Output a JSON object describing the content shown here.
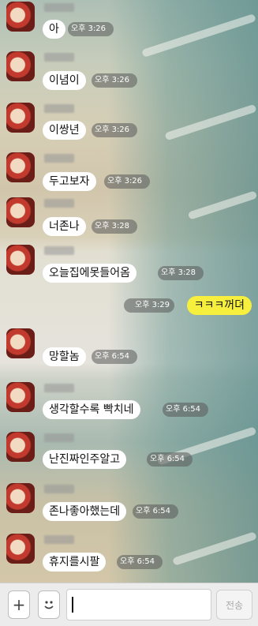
{
  "messages": [
    {
      "text": "아",
      "time": "오후 3:26"
    },
    {
      "text": "이념이",
      "time": "오후 3:26"
    },
    {
      "text": "이쌍년",
      "time": "오후 3:26"
    },
    {
      "text": "두고보자",
      "time": "오후 3:26"
    },
    {
      "text": "너존나",
      "time": "오후 3:28"
    },
    {
      "text": "오늘집에못들어옴",
      "time": "오후 3:28"
    },
    {
      "text": "ㅋㅋㅋ꺼뎌",
      "time": "오후 3:29",
      "mine": true
    },
    {
      "text": "망할놈",
      "time": "오후 6:54"
    },
    {
      "text": "생각할수록 빡치네",
      "time": "오후 6:54"
    },
    {
      "text": "난진짜인주알고",
      "time": "오후 6:54"
    },
    {
      "text": "존나좋아했는데",
      "time": "오후 6:54"
    },
    {
      "text": "휴지를시팔",
      "time": "오후 6:54"
    }
  ],
  "input": {
    "send_label": "전송",
    "plus_icon": "+",
    "emoji_icon": "smiley"
  },
  "colors": {
    "my_bubble": "#f7ef3d",
    "their_bubble": "#ffffff"
  }
}
